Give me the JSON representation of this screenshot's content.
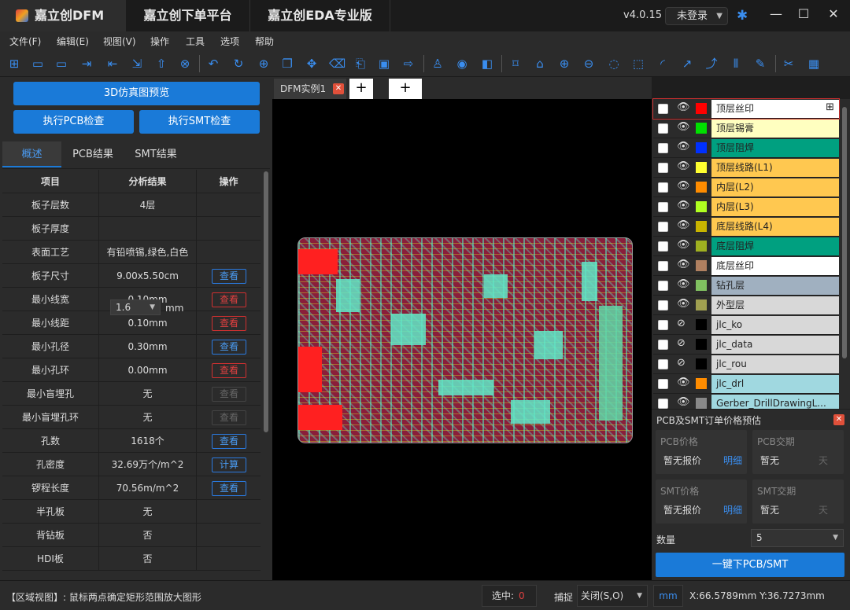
{
  "titlebar": {
    "tabs": [
      "嘉立创DFM",
      "嘉立创下单平台",
      "嘉立创EDA专业版"
    ],
    "version": "v4.0.15",
    "login": "未登录"
  },
  "menu": [
    "文件(F)",
    "编辑(E)",
    "视图(V)",
    "操作",
    "工具",
    "选项",
    "帮助"
  ],
  "left": {
    "btn_3d": "3D仿真图预览",
    "btn_pcb_check": "执行PCB检查",
    "btn_smt_check": "执行SMT检查",
    "subtabs": [
      "概述",
      "PCB结果",
      "SMT结果"
    ],
    "table_head": [
      "项目",
      "分析结果",
      "操作"
    ],
    "thickness_unit": "mm",
    "thickness_value": "1.6",
    "rows": [
      {
        "item": "板子层数",
        "result": "4层",
        "action": ""
      },
      {
        "item": "板子厚度",
        "result": "",
        "action": ""
      },
      {
        "item": "表面工艺",
        "result": "有铅喷锡,绿色,白色",
        "action": ""
      },
      {
        "item": "板子尺寸",
        "result": "9.00x5.50cm",
        "action": "查看"
      },
      {
        "item": "最小线宽",
        "result": "0.10mm",
        "action": "查看"
      },
      {
        "item": "最小线距",
        "result": "0.10mm",
        "action": "查看"
      },
      {
        "item": "最小孔径",
        "result": "0.30mm",
        "action": "查看"
      },
      {
        "item": "最小孔环",
        "result": "0.00mm",
        "action": "查看"
      },
      {
        "item": "最小盲埋孔",
        "result": "无",
        "action": "查看"
      },
      {
        "item": "最小盲埋孔环",
        "result": "无",
        "action": "查看"
      },
      {
        "item": "孔数",
        "result": "1618个",
        "action": "查看"
      },
      {
        "item": "孔密度",
        "result": "32.69万个/m^2",
        "action": "计算"
      },
      {
        "item": "锣程长度",
        "result": "70.56m/m^2",
        "action": "查看"
      },
      {
        "item": "半孔板",
        "result": "无",
        "action": ""
      },
      {
        "item": "背钻板",
        "result": "否",
        "action": ""
      },
      {
        "item": "HDI板",
        "result": "否",
        "action": ""
      }
    ]
  },
  "canvas": {
    "doc_tab": "DFM实例1",
    "plus": "+"
  },
  "layers": [
    {
      "name": "顶层丝印",
      "color": "#ff0000",
      "bg": "#ffffff",
      "visible": true
    },
    {
      "name": "顶层锡膏",
      "color": "#00e000",
      "bg": "#ffffc0",
      "visible": true
    },
    {
      "name": "顶层阻焊",
      "color": "#0030ff",
      "bg": "#00a080",
      "visible": true
    },
    {
      "name": "顶层线路(L1)",
      "color": "#ffff30",
      "bg": "#ffc850",
      "visible": true
    },
    {
      "name": "内层(L2)",
      "color": "#ff8c00",
      "bg": "#ffc850",
      "visible": true
    },
    {
      "name": "内层(L3)",
      "color": "#b0ff20",
      "bg": "#ffc850",
      "visible": true
    },
    {
      "name": "底层线路(L4)",
      "color": "#c8b400",
      "bg": "#ffc850",
      "visible": true
    },
    {
      "name": "底层阻焊",
      "color": "#a0b020",
      "bg": "#00a080",
      "visible": true
    },
    {
      "name": "底层丝印",
      "color": "#b08060",
      "bg": "#ffffff",
      "visible": true
    },
    {
      "name": "钻孔层",
      "color": "#80c060",
      "bg": "#a0b0c0",
      "visible": true
    },
    {
      "name": "外型层",
      "color": "#a0a050",
      "bg": "#d8d8d8",
      "visible": true
    },
    {
      "name": "jlc_ko",
      "color": "#000000",
      "bg": "#d8d8d8",
      "visible": false
    },
    {
      "name": "jlc_data",
      "color": "#000000",
      "bg": "#d8d8d8",
      "visible": false
    },
    {
      "name": "jlc_rou",
      "color": "#000000",
      "bg": "#d8d8d8",
      "visible": false
    },
    {
      "name": "jlc_drl",
      "color": "#ff8c00",
      "bg": "#a0d8e0",
      "visible": true
    },
    {
      "name": "Gerber_DrillDrawingL...",
      "color": "#888888",
      "bg": "#a0d8e0",
      "visible": true
    }
  ],
  "price": {
    "title": "PCB及SMT订单价格预估",
    "pcb_price_label": "PCB价格",
    "pcb_price_value": "暂无报价",
    "pcb_price_link": "明细",
    "pcb_lead_label": "PCB交期",
    "pcb_lead_value": "暂无",
    "pcb_lead_unit": "天",
    "smt_price_label": "SMT价格",
    "smt_price_value": "暂无报价",
    "smt_price_link": "明细",
    "smt_lead_label": "SMT交期",
    "smt_lead_value": "暂无",
    "smt_lead_unit": "天",
    "qty_label": "数量",
    "qty_value": "5",
    "order_button": "一键下PCB/SMT"
  },
  "status": {
    "message": "【区域视图】: 鼠标两点确定矩形范围放大图形",
    "selected_label": "选中:",
    "selected_count": "0",
    "snap_label": "捕捉",
    "snap_value": "关闭(S,O)",
    "unit": "mm",
    "coords": "X:66.5789mm Y:36.7273mm"
  }
}
